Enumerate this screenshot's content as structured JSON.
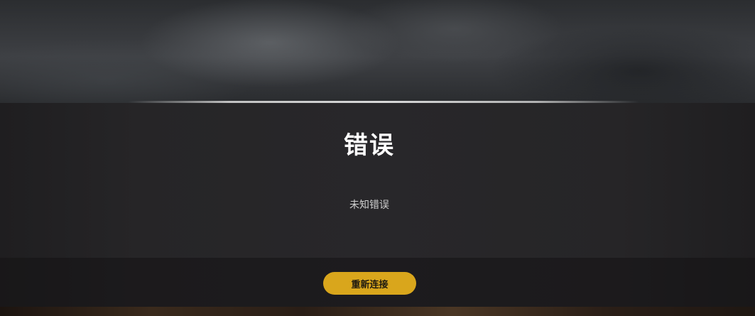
{
  "dialog": {
    "title": "错误",
    "message": "未知错误",
    "button_label": "重新连接",
    "accent_color": "#d9a61c"
  }
}
